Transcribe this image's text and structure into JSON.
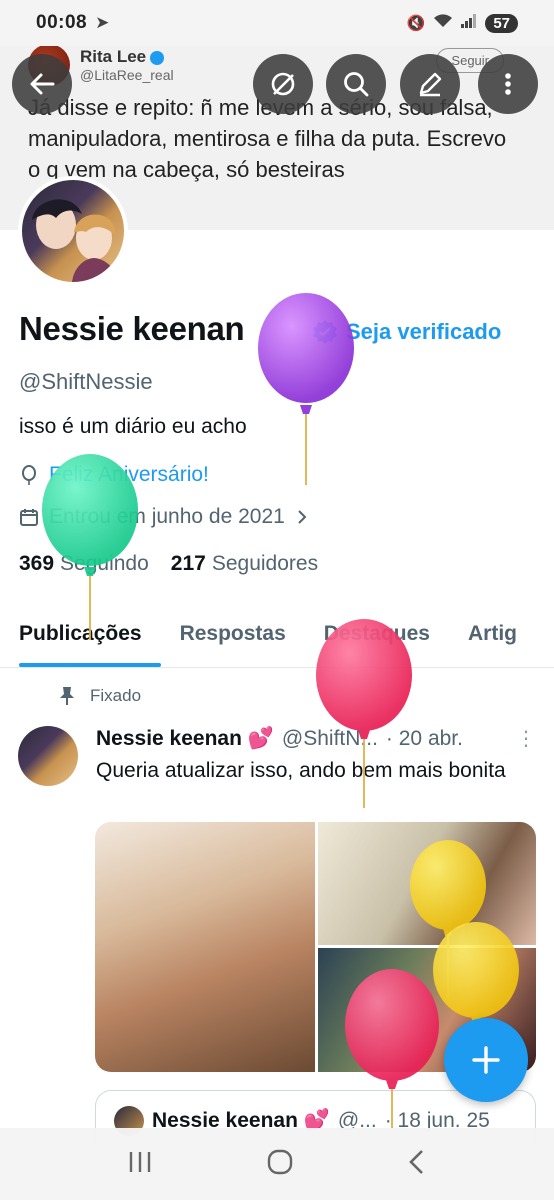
{
  "status_bar": {
    "time": "00:08",
    "battery": "57"
  },
  "banner": {
    "name": "Rita Lee",
    "handle": "@LitaRee_real",
    "follow_label": "Seguir",
    "text": "Já disse e repito: ñ me levem a sério, sou falsa, manipuladora, mentirosa e  filha da puta. Escrevo o q vem na cabeça, só besteiras"
  },
  "toolbar": {
    "back_icon": "arrow-left-icon",
    "grok_icon": "slash-circle-icon",
    "search_icon": "search-icon",
    "edit_icon": "pencil-icon",
    "more_icon": "vertical-dots-icon"
  },
  "profile": {
    "name": "Nessie keenan",
    "verify_label": "Seja verificado",
    "handle": "@ShiftNessie",
    "bio": "isso é um diário eu acho",
    "birthday": "Feliz Aniversário!",
    "joined": "Entrou em junho de 2021",
    "following_count": "369",
    "following_label": "Seguindo",
    "followers_count": "217",
    "followers_label": "Seguidores"
  },
  "tabs": [
    {
      "label": "Publicações"
    },
    {
      "label": "Respostas"
    },
    {
      "label": "Destaques"
    },
    {
      "label": "Artig"
    }
  ],
  "post": {
    "pinned_label": "Fixado",
    "author": "Nessie keenan 💕",
    "handle": "@ShiftN...",
    "date": "· 20 abr.",
    "text": "Queria atualizar isso, ando bem mais bonita"
  },
  "quote": {
    "author": "Nessie keenan 💕",
    "handle": "@...",
    "date": "· 18 jun. 25"
  },
  "colors": {
    "accent": "#1d9bf0",
    "text": "#0f1419",
    "muted": "#536471"
  }
}
